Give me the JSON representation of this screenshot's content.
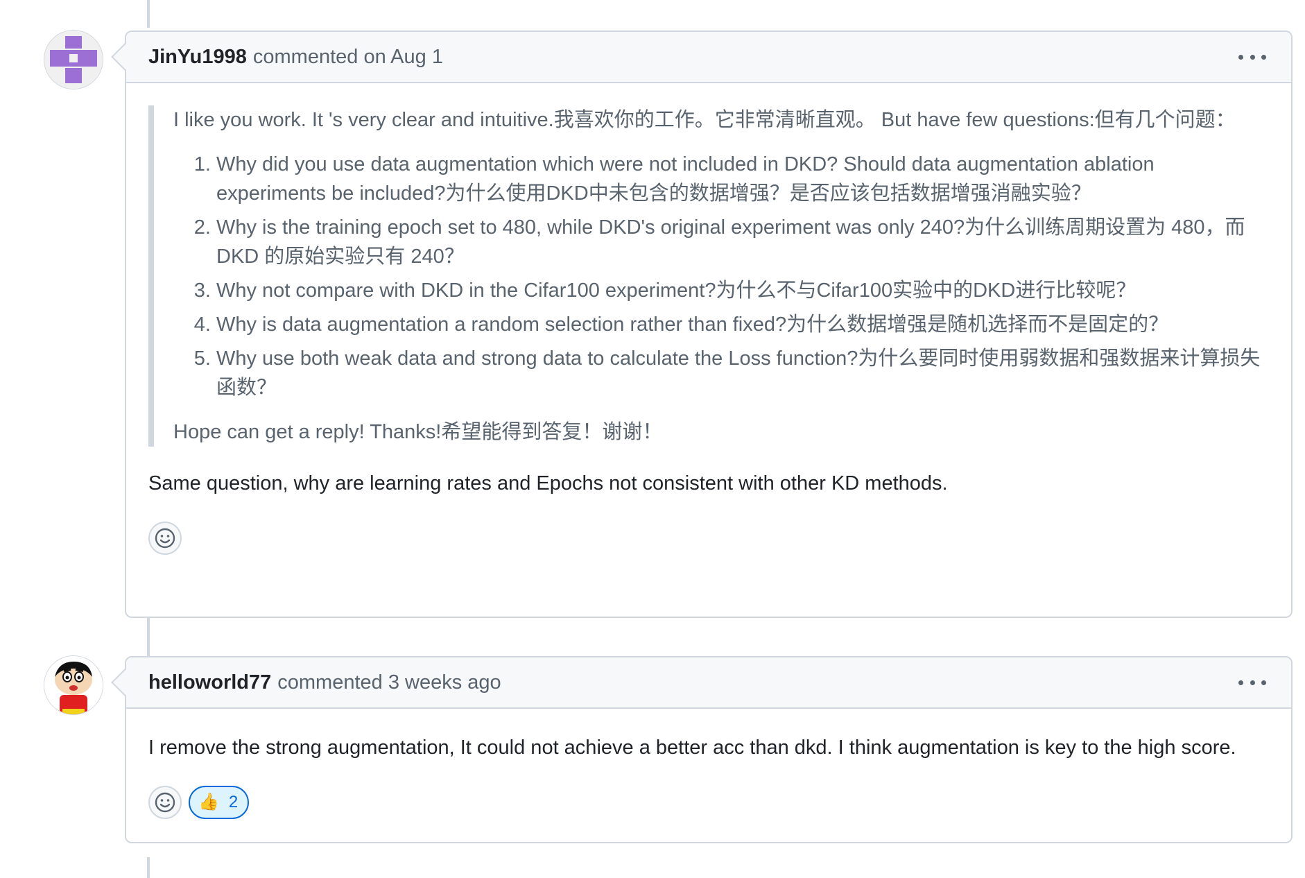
{
  "comments": [
    {
      "author": "JinYu1998",
      "meta": "commented on Aug 1",
      "quote": {
        "intro": "I like you work. It 's very clear and intuitive.我喜欢你的工作。它非常清晰直观。 But have few questions:但有几个问题：",
        "questions": [
          "Why did you use data augmentation which were not included in DKD? Should data augmentation ablation experiments be included?为什么使用DKD中未包含的数据增强？是否应该包括数据增强消融实验？",
          "Why is the training epoch set to 480, while DKD's original experiment was only 240?为什么训练周期设置为 480，而 DKD 的原始实验只有 240？",
          "Why not compare with DKD in the Cifar100 experiment?为什么不与Cifar100实验中的DKD进行比较呢？",
          "Why is data augmentation a random selection rather than fixed?为什么数据增强是随机选择而不是固定的？",
          "Why use both weak data and strong data to calculate the Loss function?为什么要同时使用弱数据和强数据来计算损失函数？"
        ],
        "outro": "Hope can get a reply! Thanks!希望能得到答复！谢谢！"
      },
      "body": "Same question, why are learning rates and Epochs not consistent with other KD methods."
    },
    {
      "author": "helloworld77",
      "meta": "commented 3 weeks ago",
      "body": "I remove the strong augmentation, It could not achieve a better acc than dkd. I think augmentation is key to the high score.",
      "reaction": {
        "emoji": "👍",
        "count": "2"
      }
    }
  ],
  "icons": {
    "kebab": "kebab-horizontal-icon",
    "add_reaction": "smiley-icon",
    "avatar1": "identicon-avatar",
    "avatar2": "cartoon-avatar"
  },
  "colors": {
    "border": "#d0d7de",
    "header_bg": "#f6f8fa",
    "muted_text": "#59636e",
    "accent": "#0969da",
    "reaction_bg": "#ddf4ff"
  }
}
